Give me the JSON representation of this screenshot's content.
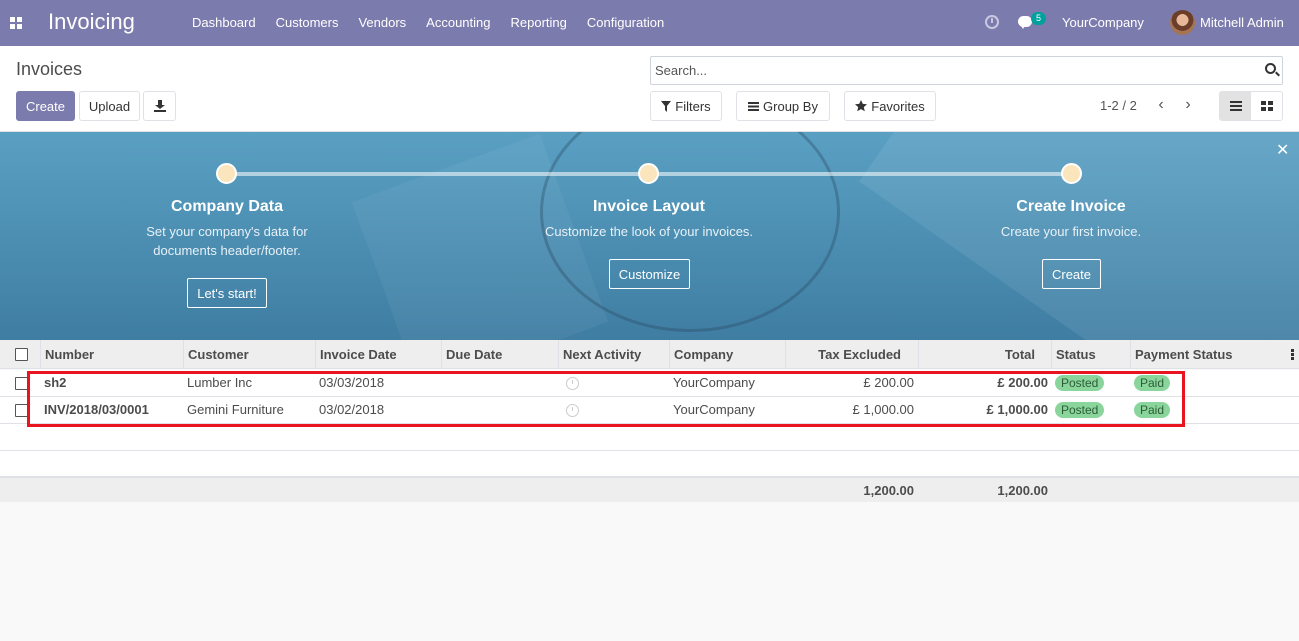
{
  "navbar": {
    "app_title": "Invoicing",
    "menu": [
      "Dashboard",
      "Customers",
      "Vendors",
      "Accounting",
      "Reporting",
      "Configuration"
    ],
    "chat_count": "5",
    "company": "YourCompany",
    "user": "Mitchell Admin",
    "accent_color": "#7c7bad"
  },
  "control_panel": {
    "breadcrumb": "Invoices",
    "create_label": "Create",
    "upload_label": "Upload",
    "search_placeholder": "Search...",
    "filters_label": "Filters",
    "groupby_label": "Group By",
    "favorites_label": "Favorites",
    "pager": "1-2 / 2"
  },
  "banner": {
    "steps": [
      {
        "title": "Company Data",
        "desc_line1": "Set your company's data for",
        "desc_line2": "documents header/footer.",
        "button": "Let's start!"
      },
      {
        "title": "Invoice Layout",
        "desc_line1": "Customize the look of your invoices.",
        "desc_line2": "",
        "button": "Customize"
      },
      {
        "title": "Create Invoice",
        "desc_line1": "Create your first invoice.",
        "desc_line2": "",
        "button": "Create"
      }
    ]
  },
  "table": {
    "columns": [
      "Number",
      "Customer",
      "Invoice Date",
      "Due Date",
      "Next Activity",
      "Company",
      "Tax Excluded",
      "Total",
      "Status",
      "Payment Status"
    ],
    "rows": [
      {
        "number": "sh2",
        "customer": "Lumber Inc",
        "invoice_date": "03/03/2018",
        "due_date": "",
        "company": "YourCompany",
        "tax_excluded": "£ 200.00",
        "total": "£ 200.00",
        "status": "Posted",
        "payment_status": "Paid"
      },
      {
        "number": "INV/2018/03/0001",
        "customer": "Gemini Furniture",
        "invoice_date": "03/02/2018",
        "due_date": "",
        "company": "YourCompany",
        "tax_excluded": "£ 1,000.00",
        "total": "£ 1,000.00",
        "status": "Posted",
        "payment_status": "Paid"
      }
    ],
    "footer": {
      "tax_excluded": "1,200.00",
      "total": "1,200.00"
    },
    "badge_color": "#89d59c"
  }
}
